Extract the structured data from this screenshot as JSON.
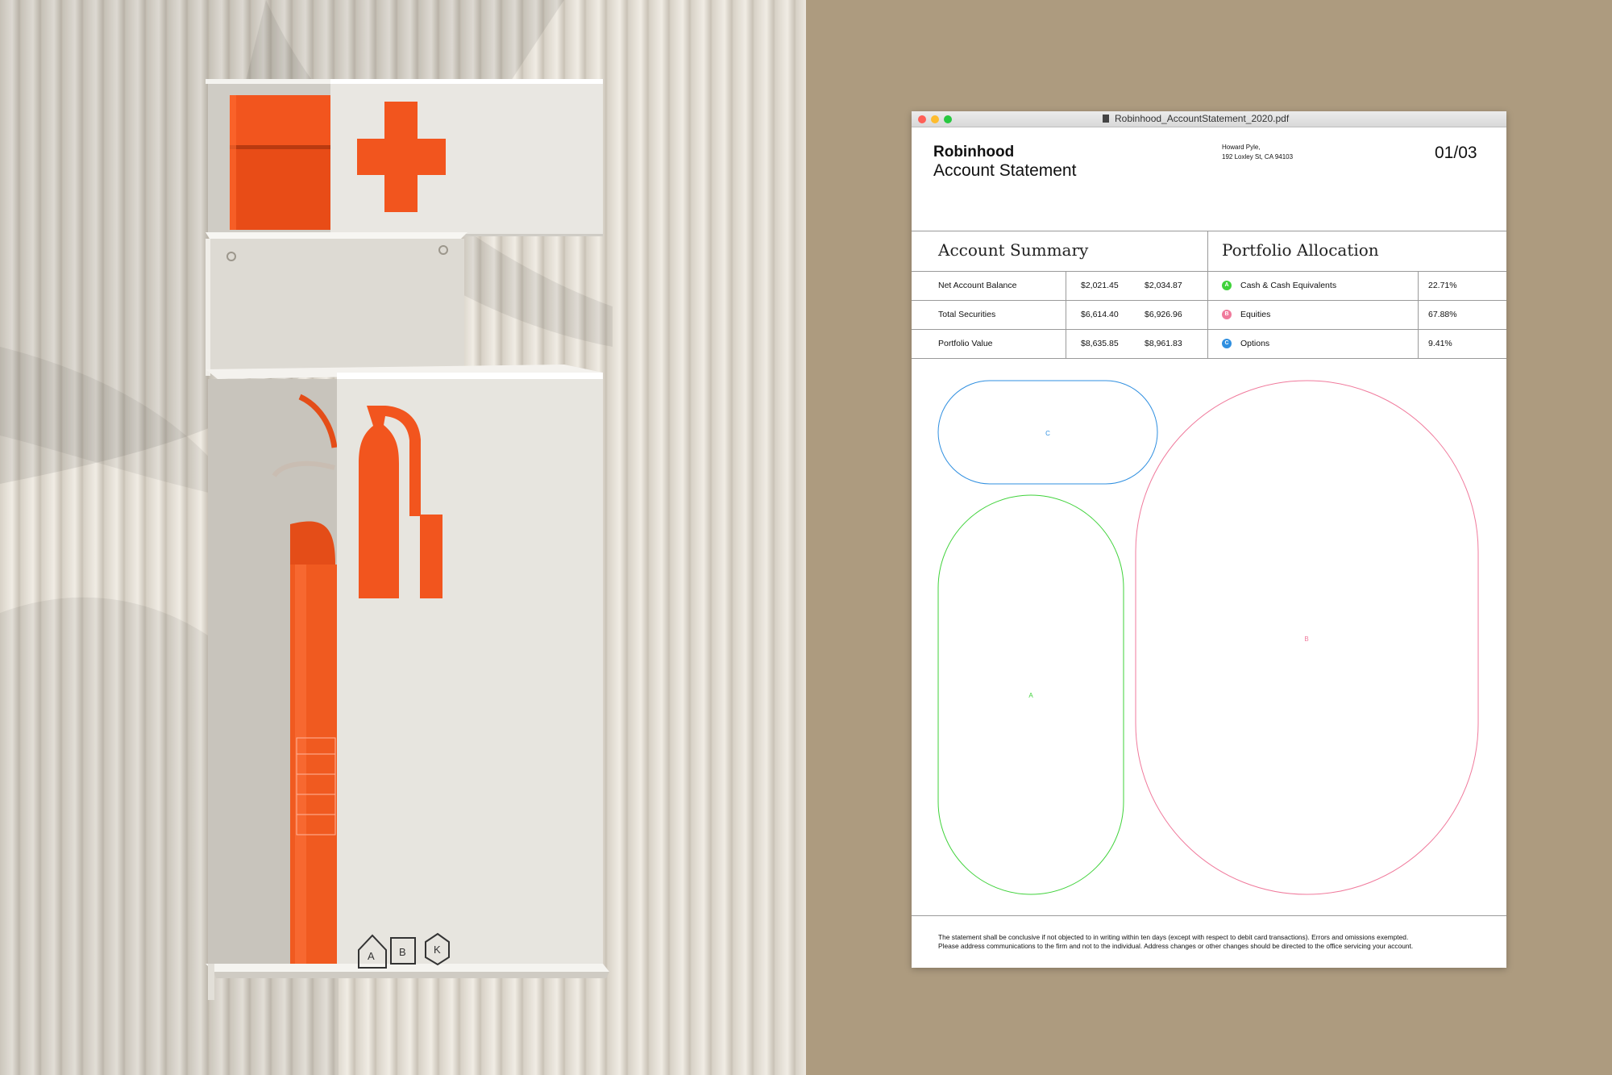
{
  "colors": {
    "background": "#ad9b7f",
    "accent_orange": "#f2551e",
    "panel_white": "#ebe9e4",
    "allocation_a": "#3fd23a",
    "allocation_b": "#f07a9c",
    "allocation_c": "#2f8fe0"
  },
  "photo": {
    "subject": "wall-mounted first aid and fire extinguisher cabinet",
    "icons": [
      "first-aid-cross-icon",
      "fire-extinguisher-icon"
    ],
    "class_labels": [
      "A",
      "B",
      "K"
    ]
  },
  "window": {
    "filename": "Robinhood_AccountStatement_2020.pdf",
    "file_icon": "pdf-file-icon"
  },
  "statement": {
    "brand": "Robinhood",
    "title": "Account Statement",
    "address_name": "Howard Pyle,",
    "address_street": "192 Loxley St, CA 94103",
    "page": "01/03"
  },
  "account_summary": {
    "heading": "Account Summary",
    "rows": [
      {
        "label": "Net Account Balance",
        "start": "$2,021.45",
        "end": "$2,034.87"
      },
      {
        "label": "Total Securities",
        "start": "$6,614.40",
        "end": "$6,926.96"
      },
      {
        "label": "Portfolio Value",
        "start": "$8,635.85",
        "end": "$8,961.83"
      }
    ]
  },
  "portfolio_allocation": {
    "heading": "Portfolio Allocation",
    "rows": [
      {
        "key": "A",
        "label": "Cash & Cash Equivalents",
        "percent": "22.71%",
        "fraction": 0.2271
      },
      {
        "key": "B",
        "label": "Equities",
        "percent": "67.88%",
        "fraction": 0.6788
      },
      {
        "key": "C",
        "label": "Options",
        "percent": "9.41%",
        "fraction": 0.0941
      }
    ]
  },
  "footer": {
    "line1": "The statement shall be conclusive if not objected to in writing within ten days (except with respect to debit card transactions). Errors and omissions exempted.",
    "line2": "Please address communications to the firm and not to the individual. Address changes or other changes should be directed to the office servicing your account."
  }
}
